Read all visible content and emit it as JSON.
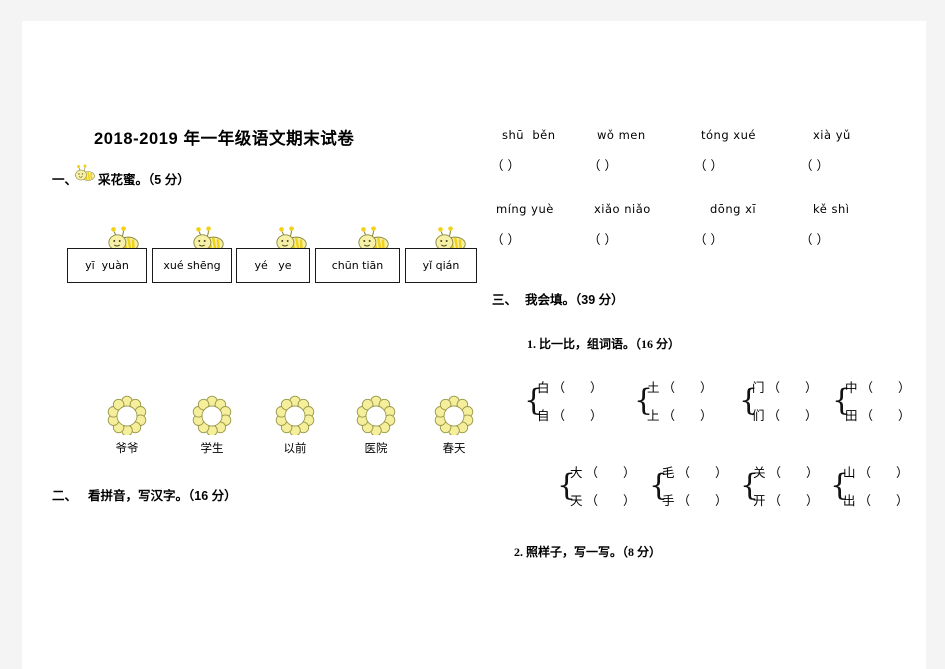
{
  "document": {
    "title": "2018-2019 年一年级语文期末试卷"
  },
  "section_one": {
    "number": "一、",
    "icon": "bee-icon",
    "title": "采花蜜。",
    "points": "（5 分）",
    "pinyin_boxes": [
      {
        "text": "yī  yuàn"
      },
      {
        "text": "xué shēng"
      },
      {
        "text": "yé   ye"
      },
      {
        "text": "chūn tiān"
      },
      {
        "text": "yǐ qián"
      }
    ],
    "flowers": [
      {
        "icon": "flower-icon",
        "label": "爷爷"
      },
      {
        "icon": "flower-icon",
        "label": "学生"
      },
      {
        "icon": "flower-icon",
        "label": "以前"
      },
      {
        "icon": "flower-icon",
        "label": "医院"
      },
      {
        "icon": "flower-icon",
        "label": "春天"
      }
    ]
  },
  "section_two": {
    "number": "二、",
    "title": "看拼音，写汉字。",
    "points": "（16 分）",
    "pinyin_rows": [
      {
        "words": [
          "shū  běn",
          "wǒ men",
          "tóng xué",
          "xià yǔ"
        ],
        "answers": [
          "（            ）",
          "（            ）",
          "（            ）",
          "（            ）"
        ]
      },
      {
        "words": [
          "míng yuè",
          "xiǎo niǎo",
          "dōng xī",
          "kě shì"
        ],
        "answers": [
          "（            ）",
          "（            ）",
          "（            ）",
          "（            ）"
        ]
      }
    ]
  },
  "section_three": {
    "number": "三、",
    "title": "我会填。",
    "points": "（39 分）",
    "sub_one": {
      "label": "1. 比一比，组词语。",
      "points": "（16 分）",
      "brace_rows": [
        [
          {
            "top_char": "白",
            "top_paren": "（        ）",
            "bottom_char": "自",
            "bottom_paren": "（        ）"
          },
          {
            "top_char": "土",
            "top_paren": "（        ）",
            "bottom_char": "上",
            "bottom_paren": "（        ）"
          },
          {
            "top_char": "门",
            "top_paren": "（        ）",
            "bottom_char": "们",
            "bottom_paren": "（        ）"
          },
          {
            "top_char": "中",
            "top_paren": "（        ）",
            "bottom_char": "田",
            "bottom_paren": "（        ）"
          }
        ],
        [
          {
            "top_char": "大",
            "top_paren": "（        ）",
            "bottom_char": "天",
            "bottom_paren": "（        ）"
          },
          {
            "top_char": "毛",
            "top_paren": "（        ）",
            "bottom_char": "手",
            "bottom_paren": "（        ）"
          },
          {
            "top_char": "关",
            "top_paren": "（        ）",
            "bottom_char": "开",
            "bottom_paren": "（        ）"
          },
          {
            "top_char": "山",
            "top_paren": "（        ）",
            "bottom_char": "出",
            "bottom_paren": "（        ）"
          }
        ]
      ]
    },
    "sub_two": {
      "label": "2. 照样子，写一写。",
      "points": "（8 分）"
    }
  },
  "colors": {
    "page_background": "#ffffff",
    "margin_background": "#f4f4f4",
    "bee_body": "#f7f0a8",
    "bee_stripe": "#f2d11a",
    "flower_petal": "#f5ef9c",
    "outline": "#8a8a3a",
    "text": "#000000"
  }
}
